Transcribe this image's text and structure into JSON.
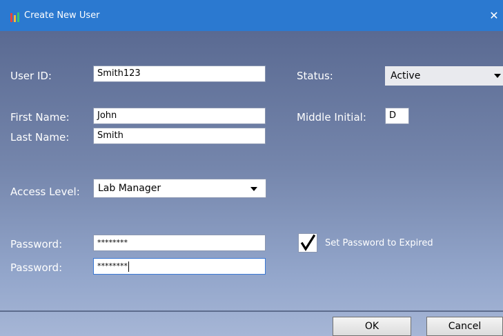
{
  "window": {
    "title": "Create New User",
    "close_glyph": "✕",
    "app_icon": "lab-bars-icon"
  },
  "form": {
    "user_id": {
      "label": "User ID:",
      "value": "Smith123"
    },
    "status": {
      "label": "Status:",
      "value": "Active"
    },
    "first_name": {
      "label": "First Name:",
      "value": "John"
    },
    "middle_initial": {
      "label": "Middle Initial:",
      "value": "D"
    },
    "last_name": {
      "label": "Last Name:",
      "value": "Smith"
    },
    "access_level": {
      "label": "Access Level:",
      "value": "Lab Manager"
    },
    "password": {
      "label": "Password:",
      "value": "********"
    },
    "password_confirm": {
      "label": "Password:",
      "value": "********"
    },
    "expire_password": {
      "label": "Set Password to Expired",
      "checked": true,
      "check_glyph": "✔"
    }
  },
  "buttons": {
    "ok": "OK",
    "cancel": "Cancel"
  },
  "colors": {
    "titlebar": "#2b79d0",
    "client_top": "#5a6a92",
    "client_bottom": "#a6b6d6"
  }
}
